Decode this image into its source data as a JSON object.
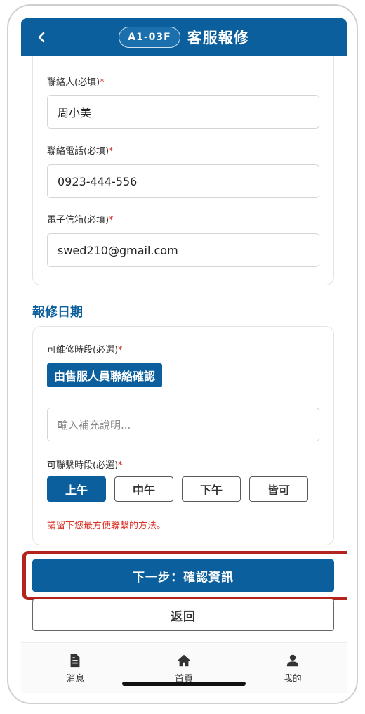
{
  "header": {
    "code": "A1-03F",
    "title": "客服報修"
  },
  "contact": {
    "name_label": "聯絡人(必填)",
    "name_value": "周小美",
    "phone_label": "聯絡電話(必填)",
    "phone_value": "0923-444-556",
    "email_label": "電子信箱(必填)",
    "email_value": "swed210@gmail.com",
    "required_mark": "*"
  },
  "schedule": {
    "section_title": "報修日期",
    "repair_period_label": "可維修時段(必選)",
    "repair_period_value": "由售服人員聯絡確認",
    "note_placeholder": "輸入補充說明...",
    "contact_period_label": "可聯繫時段(必選)",
    "slots": [
      "上午",
      "中午",
      "下午",
      "皆可"
    ],
    "selected_slot": "上午",
    "hint": "請留下您最方便聯繫的方法。"
  },
  "actions": {
    "next_label": "下一步：確認資訊",
    "return_label": "返回"
  },
  "nav": {
    "items": [
      {
        "label": "消息",
        "icon": "document-icon"
      },
      {
        "label": "首頁",
        "icon": "home-icon"
      },
      {
        "label": "我的",
        "icon": "user-icon"
      }
    ]
  },
  "colors": {
    "primary": "#0a5f9c",
    "required": "#d93025",
    "highlight": "#b3241c"
  }
}
